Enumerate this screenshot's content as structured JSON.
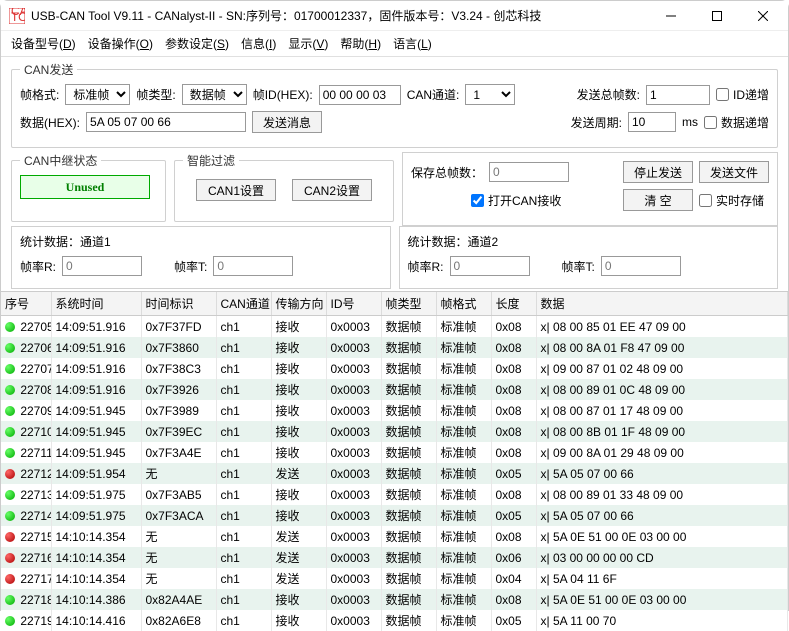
{
  "window_title": "USB-CAN Tool V9.11 - CANalyst-II - SN:序列号：01700012337，固件版本号：V3.24 - 创芯科技",
  "menus": [
    "设备型号(D)",
    "设备操作(O)",
    "参数设定(S)",
    "信息(I)",
    "显示(V)",
    "帮助(H)",
    "语言(L)"
  ],
  "send_group": {
    "legend": "CAN发送",
    "frame_fmt_label": "帧格式:",
    "frame_fmt_value": "标准帧",
    "frame_type_label": "帧类型:",
    "frame_type_value": "数据帧",
    "frame_id_label": "帧ID(HEX):",
    "frame_id_value": "00 00 00 03",
    "can_ch_label": "CAN通道:",
    "can_ch_value": "1",
    "total_send_label": "发送总帧数:",
    "total_send_value": "1",
    "id_inc_label": "ID递增",
    "data_label": "数据(HEX):",
    "data_value": "5A 05 07 00 66",
    "send_msg_btn": "发送消息",
    "period_label": "发送周期:",
    "period_value": "10",
    "ms_label": "ms",
    "data_inc_label": "数据递增"
  },
  "relay_group": {
    "legend": "CAN中继状态",
    "unused": "Unused"
  },
  "filter_group": {
    "legend": "智能过滤",
    "can1_btn": "CAN1设置",
    "can2_btn": "CAN2设置"
  },
  "right_box": {
    "save_total_label": "保存总帧数：",
    "save_total_value": "0",
    "stop_btn": "停止发送",
    "send_file_btn": "发送文件",
    "open_recv_label": "打开CAN接收",
    "clear_btn": "清 空",
    "realtime_label": "实时存储"
  },
  "stats1_title": "统计数据：通道1",
  "stats2_title": "统计数据：通道2",
  "rate_r_label": "帧率R:",
  "rate_t_label": "帧率T:",
  "stats1_r": "0",
  "stats1_t": "0",
  "stats2_r": "0",
  "stats2_t": "0",
  "columns": [
    "序号",
    "系统时间",
    "时间标识",
    "CAN通道",
    "传输方向",
    "ID号",
    "帧类型",
    "帧格式",
    "长度",
    "数据"
  ],
  "rows": [
    {
      "c": "green",
      "seq": "22705",
      "sys": "14:09:51.916",
      "tm": "0x7F37FD",
      "ch": "ch1",
      "dir": "接收",
      "id": "0x0003",
      "ft": "数据帧",
      "ff": "标准帧",
      "len": "0x08",
      "data": "x| 08 00 85 01 EE 47 09 00"
    },
    {
      "c": "green",
      "seq": "22706",
      "sys": "14:09:51.916",
      "tm": "0x7F3860",
      "ch": "ch1",
      "dir": "接收",
      "id": "0x0003",
      "ft": "数据帧",
      "ff": "标准帧",
      "len": "0x08",
      "data": "x| 08 00 8A 01 F8 47 09 00"
    },
    {
      "c": "green",
      "seq": "22707",
      "sys": "14:09:51.916",
      "tm": "0x7F38C3",
      "ch": "ch1",
      "dir": "接收",
      "id": "0x0003",
      "ft": "数据帧",
      "ff": "标准帧",
      "len": "0x08",
      "data": "x| 09 00 87 01 02 48 09 00"
    },
    {
      "c": "green",
      "seq": "22708",
      "sys": "14:09:51.916",
      "tm": "0x7F3926",
      "ch": "ch1",
      "dir": "接收",
      "id": "0x0003",
      "ft": "数据帧",
      "ff": "标准帧",
      "len": "0x08",
      "data": "x| 08 00 89 01 0C 48 09 00"
    },
    {
      "c": "green",
      "seq": "22709",
      "sys": "14:09:51.945",
      "tm": "0x7F3989",
      "ch": "ch1",
      "dir": "接收",
      "id": "0x0003",
      "ft": "数据帧",
      "ff": "标准帧",
      "len": "0x08",
      "data": "x| 08 00 87 01 17 48 09 00"
    },
    {
      "c": "green",
      "seq": "22710",
      "sys": "14:09:51.945",
      "tm": "0x7F39EC",
      "ch": "ch1",
      "dir": "接收",
      "id": "0x0003",
      "ft": "数据帧",
      "ff": "标准帧",
      "len": "0x08",
      "data": "x| 08 00 8B 01 1F 48 09 00"
    },
    {
      "c": "green",
      "seq": "22711",
      "sys": "14:09:51.945",
      "tm": "0x7F3A4E",
      "ch": "ch1",
      "dir": "接收",
      "id": "0x0003",
      "ft": "数据帧",
      "ff": "标准帧",
      "len": "0x08",
      "data": "x| 09 00 8A 01 29 48 09 00"
    },
    {
      "c": "red",
      "seq": "22712",
      "sys": "14:09:51.954",
      "tm": "无",
      "ch": "ch1",
      "dir": "发送",
      "id": "0x0003",
      "ft": "数据帧",
      "ff": "标准帧",
      "len": "0x05",
      "data": "x| 5A 05 07 00 66"
    },
    {
      "c": "green",
      "seq": "22713",
      "sys": "14:09:51.975",
      "tm": "0x7F3AB5",
      "ch": "ch1",
      "dir": "接收",
      "id": "0x0003",
      "ft": "数据帧",
      "ff": "标准帧",
      "len": "0x08",
      "data": "x| 08 00 89 01 33 48 09 00"
    },
    {
      "c": "green",
      "seq": "22714",
      "sys": "14:09:51.975",
      "tm": "0x7F3ACA",
      "ch": "ch1",
      "dir": "接收",
      "id": "0x0003",
      "ft": "数据帧",
      "ff": "标准帧",
      "len": "0x05",
      "data": "x| 5A 05 07 00 66"
    },
    {
      "c": "red",
      "seq": "22715",
      "sys": "14:10:14.354",
      "tm": "无",
      "ch": "ch1",
      "dir": "发送",
      "id": "0x0003",
      "ft": "数据帧",
      "ff": "标准帧",
      "len": "0x08",
      "data": "x| 5A 0E 51 00 0E 03 00 00"
    },
    {
      "c": "red",
      "seq": "22716",
      "sys": "14:10:14.354",
      "tm": "无",
      "ch": "ch1",
      "dir": "发送",
      "id": "0x0003",
      "ft": "数据帧",
      "ff": "标准帧",
      "len": "0x06",
      "data": "x| 03 00 00 00 00 CD"
    },
    {
      "c": "red",
      "seq": "22717",
      "sys": "14:10:14.354",
      "tm": "无",
      "ch": "ch1",
      "dir": "发送",
      "id": "0x0003",
      "ft": "数据帧",
      "ff": "标准帧",
      "len": "0x04",
      "data": "x| 5A 04 11 6F"
    },
    {
      "c": "green",
      "seq": "22718",
      "sys": "14:10:14.386",
      "tm": "0x82A4AE",
      "ch": "ch1",
      "dir": "接收",
      "id": "0x0003",
      "ft": "数据帧",
      "ff": "标准帧",
      "len": "0x08",
      "data": "x| 5A 0E 51 00 0E 03 00 00"
    },
    {
      "c": "green",
      "seq": "22719",
      "sys": "14:10:14.416",
      "tm": "0x82A6E8",
      "ch": "ch1",
      "dir": "接收",
      "id": "0x0003",
      "ft": "数据帧",
      "ff": "标准帧",
      "len": "0x05",
      "data": "x| 5A 11 00 70"
    }
  ]
}
